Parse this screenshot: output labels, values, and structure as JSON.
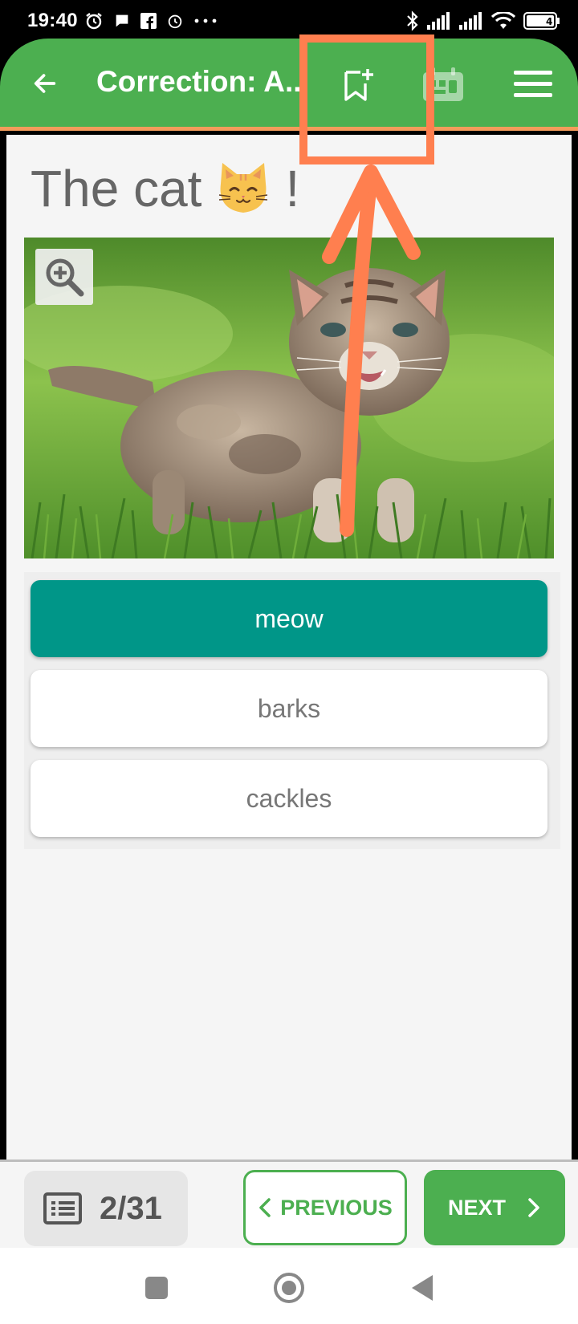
{
  "status_bar": {
    "time": "19:40",
    "left_icons": [
      "alarm-icon",
      "chat-bubble-icon",
      "facebook-icon",
      "clock-icon",
      "more-dots-icon"
    ],
    "right_icons": [
      "bluetooth-icon",
      "signal-icon",
      "signal-icon",
      "wifi-icon",
      "battery-icon"
    ],
    "battery_level": "4"
  },
  "app_bar": {
    "title": "Correction: A...",
    "color": "#4CAF50",
    "accent_line": "#F39C5B",
    "icons": [
      "back-arrow-icon",
      "bookmark-add-icon",
      "calendar-icon",
      "menu-icon"
    ]
  },
  "question": {
    "text_before": "The cat",
    "emoji": "cat-face-emoji",
    "text_after": "!",
    "image": "kitten-in-grass",
    "zoom_icon": "zoom-in-icon"
  },
  "answers": [
    {
      "label": "meow",
      "selected": true
    },
    {
      "label": "barks",
      "selected": false
    },
    {
      "label": "cackles",
      "selected": false
    }
  ],
  "bottom_bar": {
    "list_icon": "list-icon",
    "counter": "2/31",
    "previous_label": "PREVIOUS",
    "next_label": "NEXT"
  },
  "nav_bar": {
    "icons": [
      "recent-apps-icon",
      "home-icon",
      "back-triangle-icon"
    ]
  },
  "colors": {
    "primary": "#4CAF50",
    "selected_answer": "#009688",
    "annotation": "#FF7F4F"
  }
}
